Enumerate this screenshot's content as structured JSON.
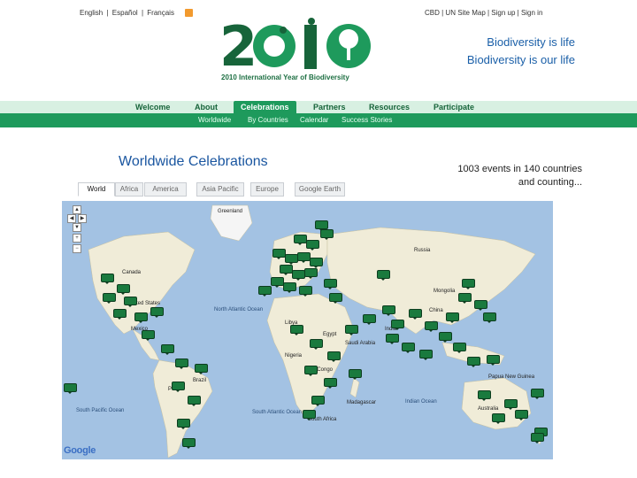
{
  "languages": [
    "English",
    "Español",
    "Français"
  ],
  "language_sep": "|",
  "toplinks": "CBD | UN      Site Map | Sign up | Sign in",
  "logo": {
    "caption": "2010 International Year of Biodiversity"
  },
  "slogan": {
    "line1": "Biodiversity is life",
    "line2": "Biodiversity is our life"
  },
  "nav": [
    "Welcome",
    "About",
    "Celebrations",
    "Partners",
    "Resources",
    "Participate"
  ],
  "subnav": [
    "Worldwide",
    "By Countries",
    "Calendar",
    "Success Stories"
  ],
  "page_title": "Worldwide Celebrations",
  "events": {
    "line1": "1003 events in 140 countries",
    "line2": "and counting..."
  },
  "map_tabs": [
    "World",
    "Africa",
    "America",
    "Asia Pacific",
    "Europe",
    "Google Earth"
  ],
  "map_labels": {
    "greenland": "Greenland",
    "canada": "Canada",
    "united_states": "United States",
    "north_atlantic": "North Atlantic Ocean",
    "mexico": "Mexico",
    "russia": "Russia",
    "mongolia": "Mongolia",
    "china": "China",
    "libya": "Libya",
    "egypt": "Egypt",
    "saudi": "Saudi Arabia",
    "india": "India",
    "nigeria": "Nigeria",
    "drc": "DR Congo",
    "south_atlantic": "South Atlantic Ocean",
    "south_africa": "South Africa",
    "madagascar": "Madagascar",
    "indian_ocean": "Indian Ocean",
    "brazil": "Brazil",
    "peru": "Peru",
    "south_pacific": "South Pacific Ocean",
    "australia": "Australia",
    "papua": "Papua New Guinea"
  },
  "map_attribution": "Google",
  "colors": {
    "nav_bg": "#d8f0e2",
    "subnav_bg": "#1e9a5c",
    "brand_green": "#1a7a3e",
    "title_blue": "#1a56a0",
    "ocean": "#a3c2e3",
    "land": "#f0ecd8"
  }
}
